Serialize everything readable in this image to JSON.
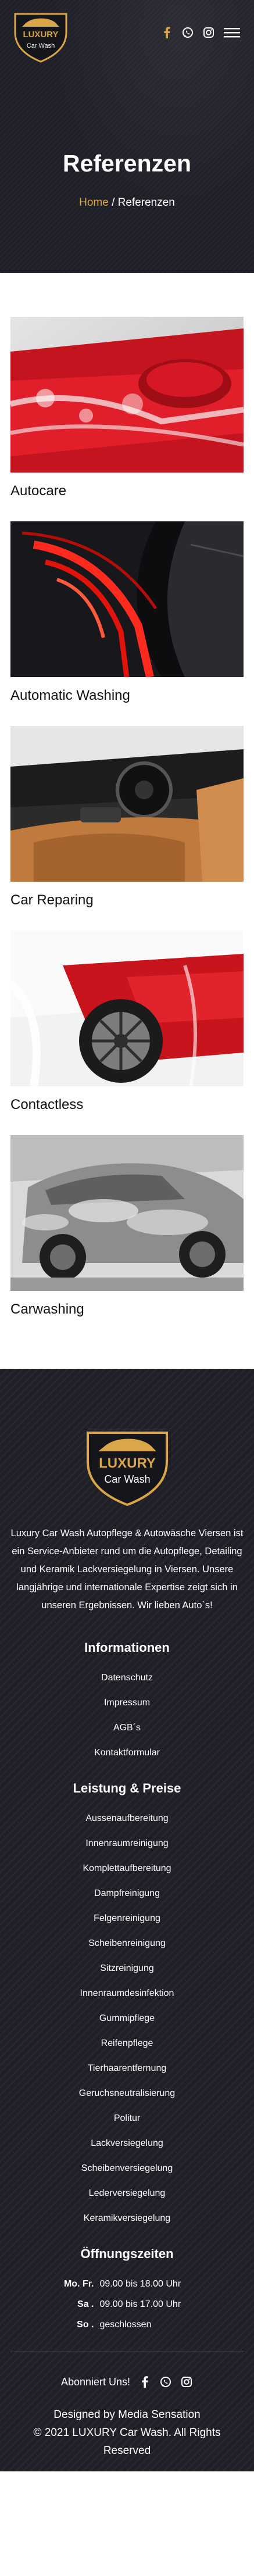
{
  "brand": {
    "logo_top": "LUXURY",
    "logo_bottom": "Car Wash"
  },
  "colors": {
    "accent": "#d9a648",
    "dark": "#1f1f28"
  },
  "header": {
    "icons": [
      "facebook-icon",
      "whatsapp-icon",
      "instagram-icon",
      "menu-icon"
    ]
  },
  "hero": {
    "title": "Referenzen",
    "breadcrumb_home": "Home",
    "breadcrumb_sep": " / ",
    "breadcrumb_current": "Referenzen"
  },
  "gallery": {
    "items": [
      {
        "title": "Autocare"
      },
      {
        "title": "Automatic Washing"
      },
      {
        "title": "Car Reparing"
      },
      {
        "title": "Contactless"
      },
      {
        "title": "Carwashing"
      }
    ]
  },
  "footer": {
    "about": "Luxury Car Wash Autopflege & Autowäsche Viersen ist ein Service-Anbieter rund um die Autopflege, Detailing und Keramik Lackversiegelung in Viersen. Unsere langjährige und internationale Expertise zeigt sich in unseren Ergebnissen. Wir lieben Auto`s!",
    "info_heading": "Informationen",
    "info_links": [
      "Datenschutz",
      "Impressum",
      "AGB´s",
      "Kontaktformular"
    ],
    "services_heading": "Leistung & Preise",
    "services": [
      "Aussenaufbereitung",
      "Innenraumreinigung",
      "Komplettaufbereitung",
      "Dampfreinigung",
      "Felgenreinigung",
      "Scheibenreinigung",
      "Sitzreinigung",
      "Innenraumdesinfektion",
      "Gummipflege",
      "Reifenpflege",
      "Tierhaarentfernung",
      "Geruchsneutralisierung",
      "Politur",
      "Lackversiegelung",
      "Scheibenversiegelung",
      "Lederversiegelung",
      "Keramikversiegelung"
    ],
    "hours_heading": "Öffnungszeiten",
    "hours": [
      {
        "day": "Mo. Fr.",
        "time": "09.00 bis 18.00 Uhr"
      },
      {
        "day": "Sa .",
        "time": "09.00 bis 17.00 Uhr"
      },
      {
        "day": "So .",
        "time": "geschlossen"
      }
    ],
    "follow_label": "Abonniert Uns!",
    "designed_by": "Designed by Media Sensation",
    "copyright": "© 2021 LUXURY Car Wash. All Rights Reserved"
  }
}
